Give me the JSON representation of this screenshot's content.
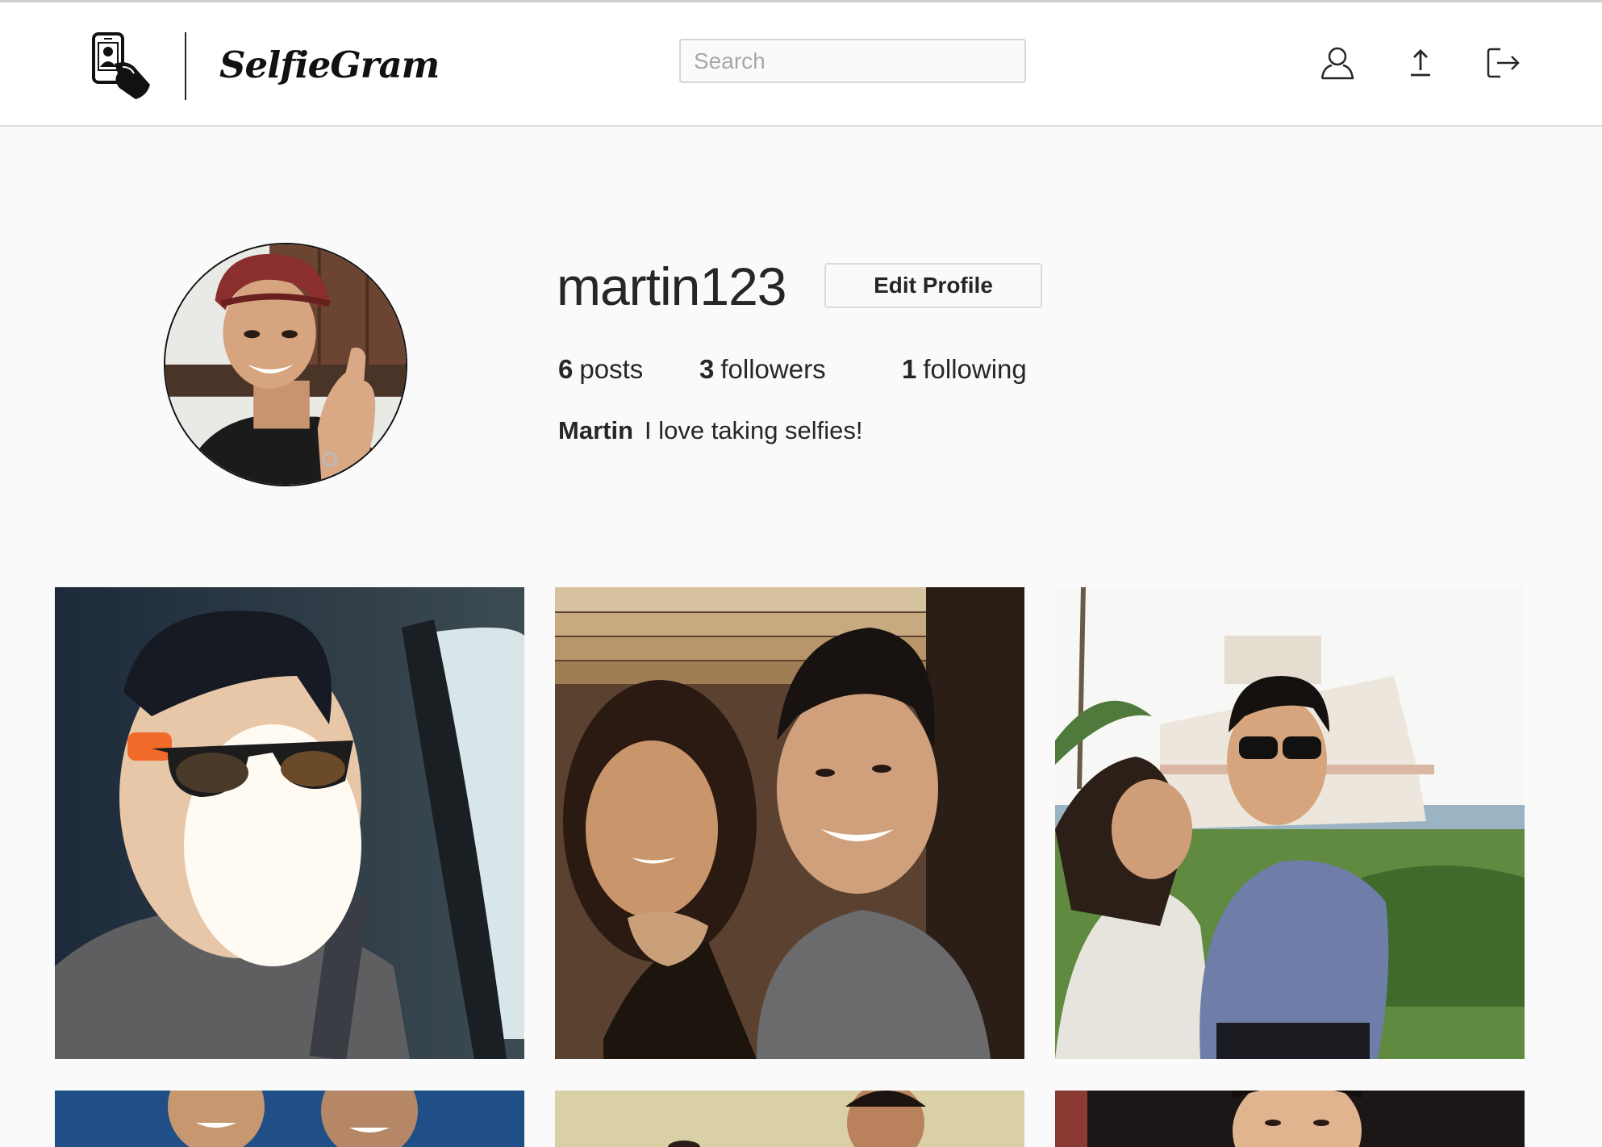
{
  "app": {
    "brand": "SelfieGram",
    "accent_color": "#262626"
  },
  "navbar": {
    "search_placeholder": "Search",
    "icons": [
      "profile-icon",
      "upload-icon",
      "logout-icon"
    ]
  },
  "profile": {
    "username": "martin123",
    "edit_button_label": "Edit Profile",
    "stats": {
      "posts_count": "6",
      "posts_label": "posts",
      "followers_count": "3",
      "followers_label": "followers",
      "following_count": "1",
      "following_label": "following"
    },
    "bio": {
      "name": "Martin",
      "text": "I love taking selfies!"
    }
  },
  "posts": [
    {
      "id": 1,
      "subject": "car selfie with sunglasses"
    },
    {
      "id": 2,
      "subject": "couple selfie indoors"
    },
    {
      "id": 3,
      "subject": "couple in front of beach house"
    },
    {
      "id": 4,
      "subject": "two men, blue background"
    },
    {
      "id": 5,
      "subject": "man smiling, yellow wall"
    },
    {
      "id": 6,
      "subject": "man smiling, dark background"
    }
  ]
}
